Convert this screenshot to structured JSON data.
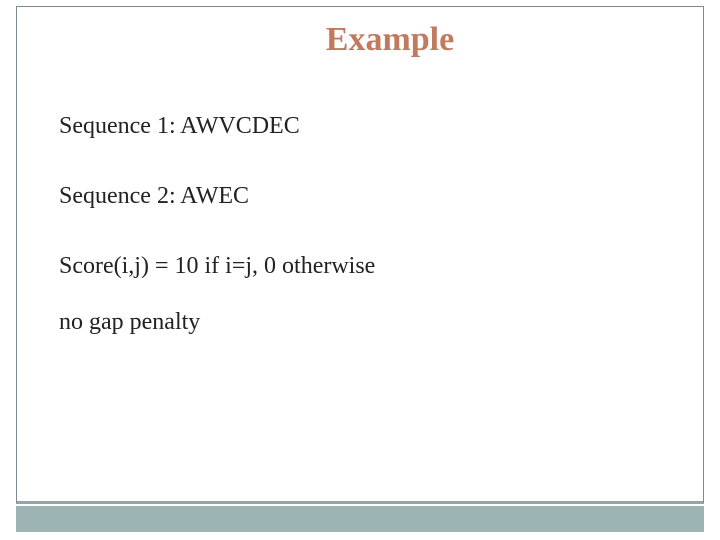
{
  "title": "Example",
  "lines": {
    "seq1": "Sequence 1: AWVCDEC",
    "seq2": "Sequence 2: AWEC",
    "score": "Score(i,j) = 10 if i=j, 0 otherwise",
    "gap": "no gap penalty"
  },
  "colors": {
    "title": "#c17a5d",
    "border": "#7a8a93",
    "footer": "#9db4b4"
  }
}
